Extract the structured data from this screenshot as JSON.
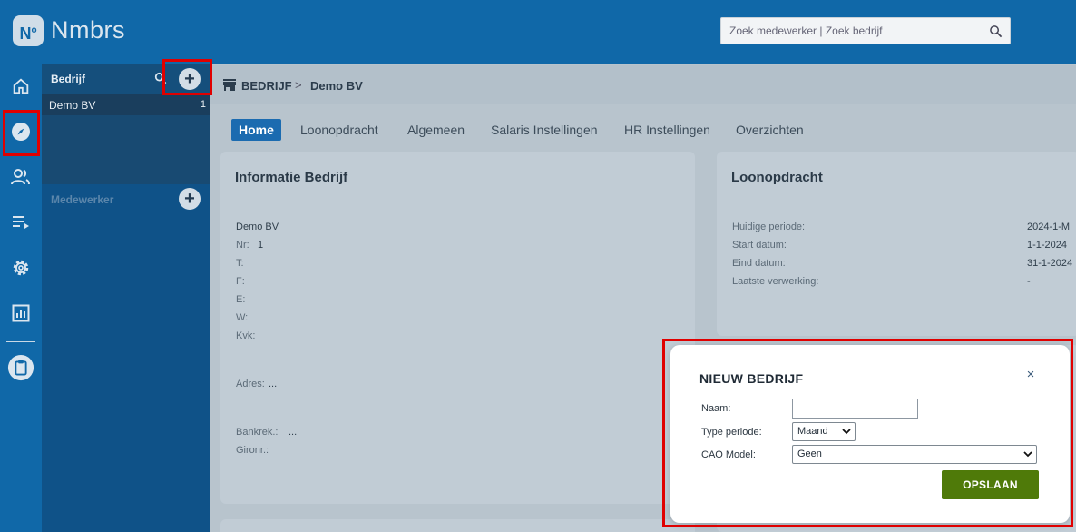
{
  "app": {
    "logo_text": "N",
    "logo_sup": "o",
    "name": "Nmbrs"
  },
  "search": {
    "placeholder": "Zoek medewerker | Zoek bedrijf",
    "icon": "search-icon"
  },
  "rail": {
    "items": [
      "home-icon",
      "compass-icon",
      "users-icon",
      "playlist-icon",
      "gear-icon",
      "bar-chart-icon",
      "clipboard-icon"
    ]
  },
  "sidebar": {
    "company_section_title": "Bedrijf",
    "company_add": "+",
    "companies": [
      {
        "name": "Demo BV",
        "count": "1"
      }
    ],
    "employee_section_title": "Medewerker",
    "employee_add": "+"
  },
  "breadcrumb": {
    "root": "BEDRIJF",
    "separator": ">",
    "current": "Demo BV"
  },
  "tabs": [
    "Home",
    "Loonopdracht",
    "Algemeen",
    "Salaris Instellingen",
    "HR Instellingen",
    "Overzichten"
  ],
  "info_card": {
    "title": "Informatie Bedrijf",
    "company_name": "Demo BV",
    "nr_label": "Nr:",
    "nr_value": "1",
    "t_label": "T:",
    "f_label": "F:",
    "e_label": "E:",
    "w_label": "W:",
    "kvk_label": "Kvk:",
    "adres_label": "Adres:",
    "adres_value": "...",
    "bankrek_label": "Bankrek.:",
    "bankrek_value": "...",
    "gironr_label": "Gironr.:"
  },
  "loon_card": {
    "title": "Loonopdracht",
    "rows": [
      {
        "label": "Huidige periode:",
        "value": "2024-1-M"
      },
      {
        "label": "Start datum:",
        "value": "1-1-2024"
      },
      {
        "label": "Eind datum:",
        "value": "31-1-2024"
      },
      {
        "label": "Laatste verwerking:",
        "value": "-"
      }
    ]
  },
  "modal": {
    "title": "NIEUW BEDRIJF",
    "close": "×",
    "naam_label": "Naam:",
    "naam_value": "",
    "type_label": "Type periode:",
    "type_value": "Maand",
    "cao_label": "CAO Model:",
    "cao_value": "Geen",
    "save_label": "OPSLAAN"
  },
  "colors": {
    "header": "#1068a8",
    "sidebar": "#0f5288",
    "save": "#4f7a09",
    "highlight": "#e00000",
    "active_tab": "#1b6bb0"
  }
}
